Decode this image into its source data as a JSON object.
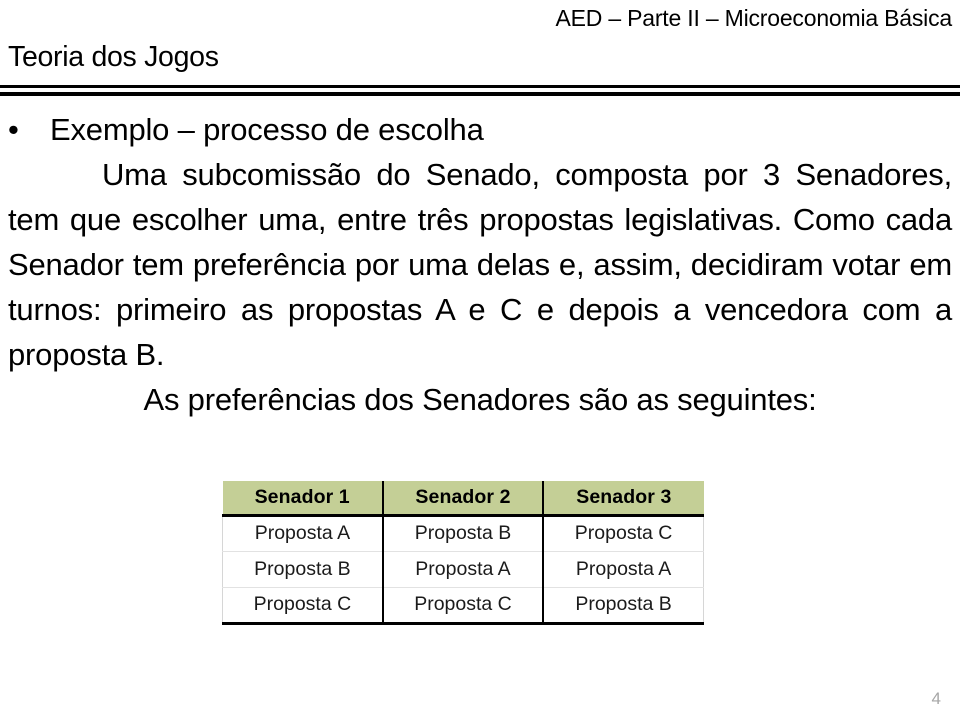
{
  "header": {
    "course_title": "AED – Parte II – Microeconomia Básica",
    "slide_title": "Teoria dos Jogos"
  },
  "content": {
    "bullet_marker": "•",
    "bullet_text": "Exemplo – processo de escolha",
    "paragraph": "Uma subcomissão do Senado, composta por 3 Senadores, tem que escolher uma, entre três propostas legislativas. Como cada Senador tem preferência por uma delas e, assim, decidiram votar em turnos: primeiro as propostas A e C e depois a vencedora com a proposta B.",
    "closing_line": "As preferências dos Senadores são as seguintes:"
  },
  "table": {
    "headers": [
      "Senador 1",
      "Senador 2",
      "Senador 3"
    ],
    "rows": [
      [
        "Proposta A",
        "Proposta B",
        "Proposta C"
      ],
      [
        "Proposta B",
        "Proposta A",
        "Proposta A"
      ],
      [
        "Proposta C",
        "Proposta C",
        "Proposta B"
      ]
    ],
    "header_background": "#c4cf96",
    "border_color": "#000000"
  },
  "footer": {
    "page_number": "4"
  }
}
